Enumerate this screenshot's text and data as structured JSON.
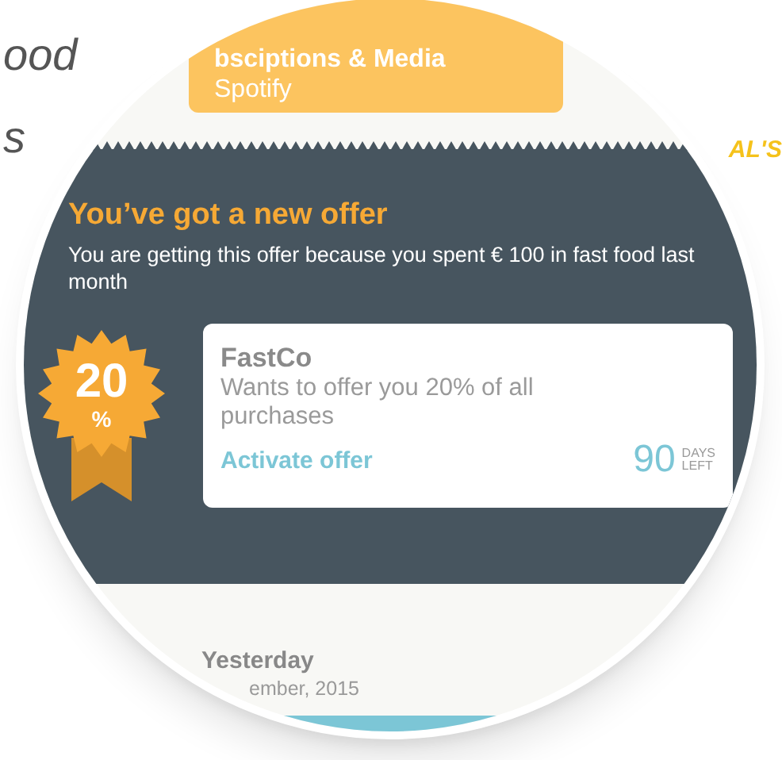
{
  "background": {
    "fragments": [
      "ood",
      "s"
    ],
    "logo": "AL'S"
  },
  "category_chip": {
    "category": "bsciptions & Media",
    "merchant": "Spotify"
  },
  "offer_panel": {
    "title": "You’ve got a new offer",
    "reason": "You are getting this offer because you spent € 100 in fast food last month",
    "badge": {
      "value": "20",
      "unit": "%"
    },
    "card": {
      "company": "FastCo",
      "message": "Wants to offer you 20% of all purchases",
      "action": "Activate offer",
      "days": "90",
      "days_label": [
        "DAYS",
        "LEFT"
      ]
    }
  },
  "history": {
    "heading": "Yesterday",
    "date": "ember, 2015"
  }
}
